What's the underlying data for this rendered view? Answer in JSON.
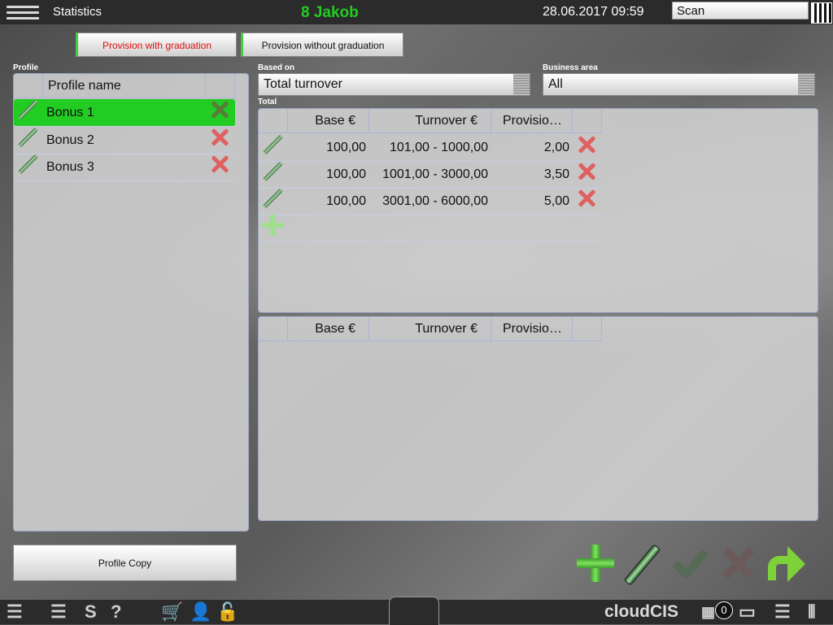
{
  "topbar": {
    "title": "Statistics",
    "user": "8 Jakob",
    "datetime": "28.06.2017 09:59",
    "scan_placeholder": "Scan"
  },
  "tabs": [
    {
      "label": "Provision with graduation",
      "active": true
    },
    {
      "label": "Provision without graduation",
      "active": false
    }
  ],
  "labels": {
    "profile": "Profile",
    "based_on": "Based on",
    "business_area": "Business area",
    "total": "Total"
  },
  "profile": {
    "header": "Profile name",
    "rows": [
      {
        "name": "Bonus 1",
        "selected": true
      },
      {
        "name": "Bonus 2",
        "selected": false
      },
      {
        "name": "Bonus 3",
        "selected": false
      }
    ]
  },
  "based_on": {
    "value": "Total turnover"
  },
  "business_area": {
    "value": "All"
  },
  "total_table": {
    "headers": [
      "Base €",
      "Turnover €",
      "Provisio…"
    ],
    "rows": [
      {
        "base": "100,00",
        "turnover": "101,00 - 1000,00",
        "provision": "2,00"
      },
      {
        "base": "100,00",
        "turnover": "1001,00 - 3000,00",
        "provision": "3,50"
      },
      {
        "base": "100,00",
        "turnover": "3001,00 - 6000,00",
        "provision": "5,00"
      }
    ]
  },
  "lower_table": {
    "headers": [
      "Base €",
      "Turnover €",
      "Provisio…"
    ]
  },
  "buttons": {
    "profile_copy": "Profile Copy"
  },
  "bottombar": {
    "brand": "cloudCIS",
    "badge_count": "0"
  },
  "colors": {
    "accent_green": "#22cc22",
    "selected_row": "#22cc22",
    "active_tab_text": "#e01010",
    "bar_bg": "#2b2b2b"
  }
}
